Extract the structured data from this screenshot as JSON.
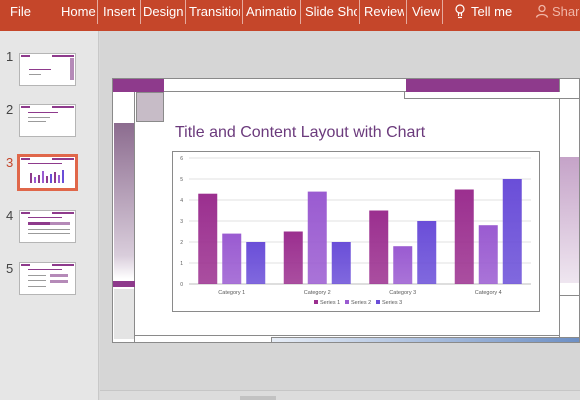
{
  "ribbon": {
    "tabs": [
      "File",
      "Home",
      "Insert",
      "Design",
      "Transitior",
      "Animatio",
      "Slide Sho",
      "Review",
      "View"
    ],
    "tell_me": "Tell me",
    "share": "Shar"
  },
  "thumbnails": [
    {
      "number": "1",
      "active": false
    },
    {
      "number": "2",
      "active": false
    },
    {
      "number": "3",
      "active": true
    },
    {
      "number": "4",
      "active": false
    },
    {
      "number": "5",
      "active": false
    }
  ],
  "slide": {
    "title": "Title and Content Layout with Chart"
  },
  "colors": {
    "ribbon": "#c5462a",
    "accent_purple": "#8e3a8c",
    "series_1": "#9b2f8f",
    "series_2": "#9a5bd1",
    "series_3": "#6a4ed8"
  },
  "chart_data": {
    "type": "bar",
    "categories": [
      "Category 1",
      "Category 2",
      "Category 3",
      "Category 4"
    ],
    "series": [
      {
        "name": "Series 1",
        "values": [
          4.3,
          2.5,
          3.5,
          4.5
        ]
      },
      {
        "name": "Series 2",
        "values": [
          2.4,
          4.4,
          1.8,
          2.8
        ]
      },
      {
        "name": "Series 3",
        "values": [
          2.0,
          2.0,
          3.0,
          5.0
        ]
      }
    ],
    "yticks": [
      "0",
      "1",
      "2",
      "3",
      "4",
      "5",
      "6"
    ],
    "ylim": [
      0,
      6
    ],
    "grid": true,
    "legend_position": "bottom"
  }
}
